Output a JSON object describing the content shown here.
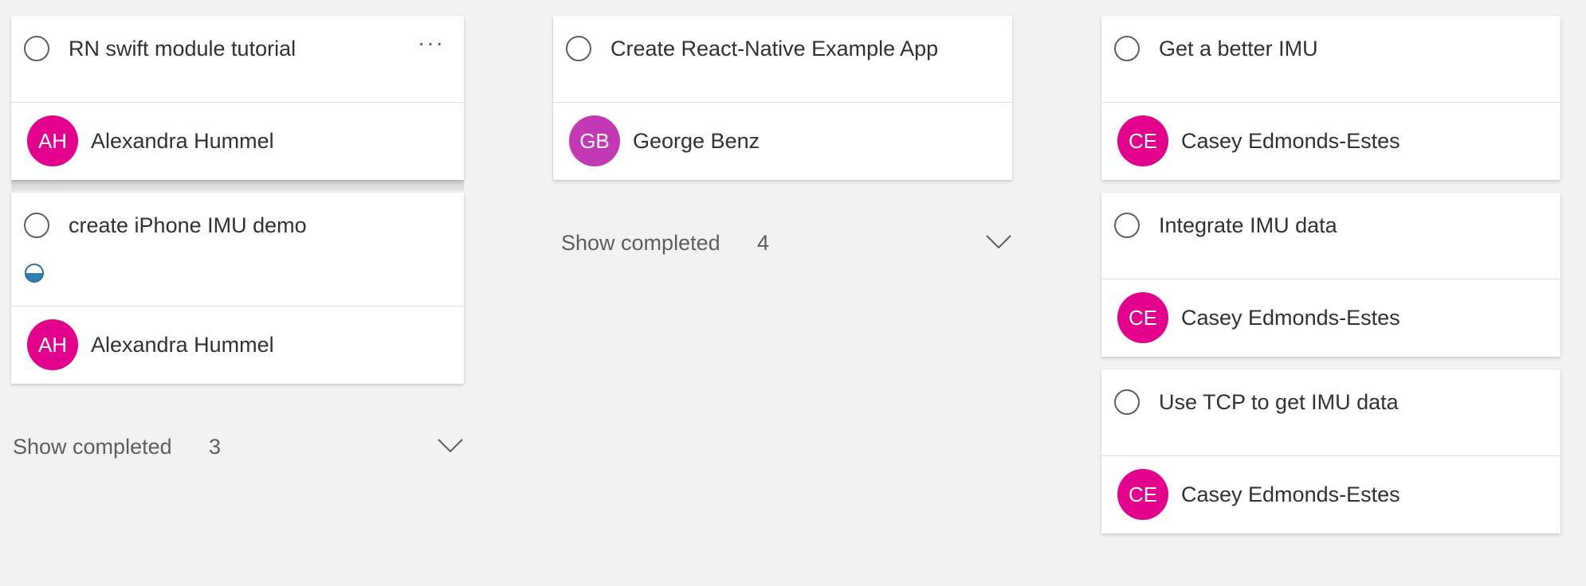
{
  "columns": [
    {
      "cards": [
        {
          "title": "RN swift module tutorial",
          "more_label": "···",
          "assignee": "Alexandra Hummel",
          "initials": "AH",
          "avatar_color": "#e3008c"
        },
        {
          "title": "create iPhone IMU demo",
          "assignee": "Alexandra Hummel",
          "initials": "AH",
          "avatar_color": "#e3008c",
          "progress": "in-progress"
        }
      ],
      "show_completed": {
        "label": "Show completed",
        "count": "3"
      }
    },
    {
      "cards": [
        {
          "title": "Create React-Native Example App",
          "assignee": "George Benz",
          "initials": "GB",
          "avatar_color": "#c239b3"
        }
      ],
      "show_completed": {
        "label": "Show completed",
        "count": "4"
      }
    },
    {
      "cards": [
        {
          "title": "Get a better IMU",
          "assignee": "Casey Edmonds-Estes",
          "initials": "CE",
          "avatar_color": "#e3008c"
        },
        {
          "title": "Integrate IMU data",
          "assignee": "Casey Edmonds-Estes",
          "initials": "CE",
          "avatar_color": "#e3008c"
        },
        {
          "title": "Use TCP to get IMU data",
          "assignee": "Casey Edmonds-Estes",
          "initials": "CE",
          "avatar_color": "#e3008c"
        }
      ]
    }
  ],
  "icons": {
    "checkbox": "complete-task-circle-icon",
    "progress": "half-filled-circle-icon",
    "more": "more-options-icon",
    "expand": "chevron-down-icon"
  }
}
